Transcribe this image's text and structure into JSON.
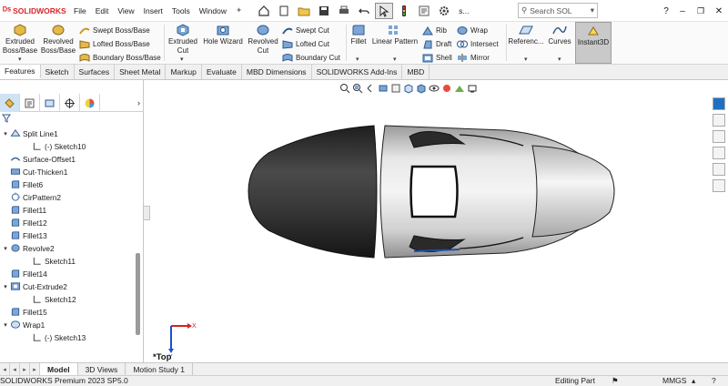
{
  "app": {
    "logo_text": "SOLIDWORKS",
    "search_placeholder": "Search SOL",
    "user_initial": "s..."
  },
  "menu": [
    "File",
    "Edit",
    "View",
    "Insert",
    "Tools",
    "Window"
  ],
  "commands": {
    "extruded_boss": [
      "Extruded",
      "Boss/Base"
    ],
    "revolved_boss": [
      "Revolved",
      "Boss/Base"
    ],
    "swept_boss": "Swept Boss/Base",
    "lofted_boss": "Lofted Boss/Base",
    "boundary_boss": "Boundary Boss/Base",
    "extruded_cut": [
      "Extruded",
      "Cut"
    ],
    "hole_wizard": "Hole Wizard",
    "revolved_cut": [
      "Revolved",
      "Cut"
    ],
    "swept_cut": "Swept Cut",
    "lofted_cut": "Lofted Cut",
    "boundary_cut": "Boundary Cut",
    "fillet": "Fillet",
    "linear_pattern": "Linear Pattern",
    "rib": "Rib",
    "draft": "Draft",
    "shell": "Shell",
    "wrap": "Wrap",
    "intersect": "Intersect",
    "mirror": "Mirror",
    "reference": "Referenc...",
    "curves": "Curves",
    "instant3d": "Instant3D"
  },
  "tabs": [
    "Features",
    "Sketch",
    "Surfaces",
    "Sheet Metal",
    "Markup",
    "Evaluate",
    "MBD Dimensions",
    "SOLIDWORKS Add-Ins",
    "MBD"
  ],
  "tree": [
    {
      "label": "Split Line1",
      "level": 0,
      "arrow": "▾",
      "icon": "split-line-icon"
    },
    {
      "label": "(-) Sketch10",
      "level": 1,
      "arrow": "",
      "icon": "sketch-icon"
    },
    {
      "label": "Surface-Offset1",
      "level": 0,
      "arrow": "",
      "icon": "surface-offset-icon"
    },
    {
      "label": "Cut-Thicken1",
      "level": 0,
      "arrow": "",
      "icon": "cut-thicken-icon"
    },
    {
      "label": "Fillet6",
      "level": 0,
      "arrow": "",
      "icon": "fillet-icon"
    },
    {
      "label": "CirPattern2",
      "level": 0,
      "arrow": "",
      "icon": "circular-pattern-icon"
    },
    {
      "label": "Fillet11",
      "level": 0,
      "arrow": "",
      "icon": "fillet-icon"
    },
    {
      "label": "Fillet12",
      "level": 0,
      "arrow": "",
      "icon": "fillet-icon"
    },
    {
      "label": "Fillet13",
      "level": 0,
      "arrow": "",
      "icon": "fillet-icon"
    },
    {
      "label": "Revolve2",
      "level": 0,
      "arrow": "▾",
      "icon": "revolve-icon"
    },
    {
      "label": "Sketch11",
      "level": 1,
      "arrow": "",
      "icon": "sketch-icon"
    },
    {
      "label": "Fillet14",
      "level": 0,
      "arrow": "",
      "icon": "fillet-icon"
    },
    {
      "label": "Cut-Extrude2",
      "level": 0,
      "arrow": "▾",
      "icon": "cut-extrude-icon"
    },
    {
      "label": "Sketch12",
      "level": 1,
      "arrow": "",
      "icon": "sketch-icon"
    },
    {
      "label": "Fillet15",
      "level": 0,
      "arrow": "",
      "icon": "fillet-icon"
    },
    {
      "label": "Wrap1",
      "level": 0,
      "arrow": "▾",
      "icon": "wrap-icon"
    },
    {
      "label": "(-) Sketch13",
      "level": 1,
      "arrow": "",
      "icon": "sketch-icon"
    }
  ],
  "viewport": {
    "view_label": "*Top",
    "triad_x": "X",
    "triad_y": "Y"
  },
  "bottom_tabs": [
    "Model",
    "3D Views",
    "Motion Study 1"
  ],
  "status": {
    "version": "SOLIDWORKS Premium 2023 SP5.0",
    "mode": "Editing Part",
    "units": "MMGS"
  },
  "colors": {
    "brand_red": "#d7262b",
    "accent_blue": "#1f6fc4",
    "instant3d_bg": "#c9c9c9",
    "rubber_cap": "#2e2e2e",
    "metal_body": "#dadada"
  }
}
